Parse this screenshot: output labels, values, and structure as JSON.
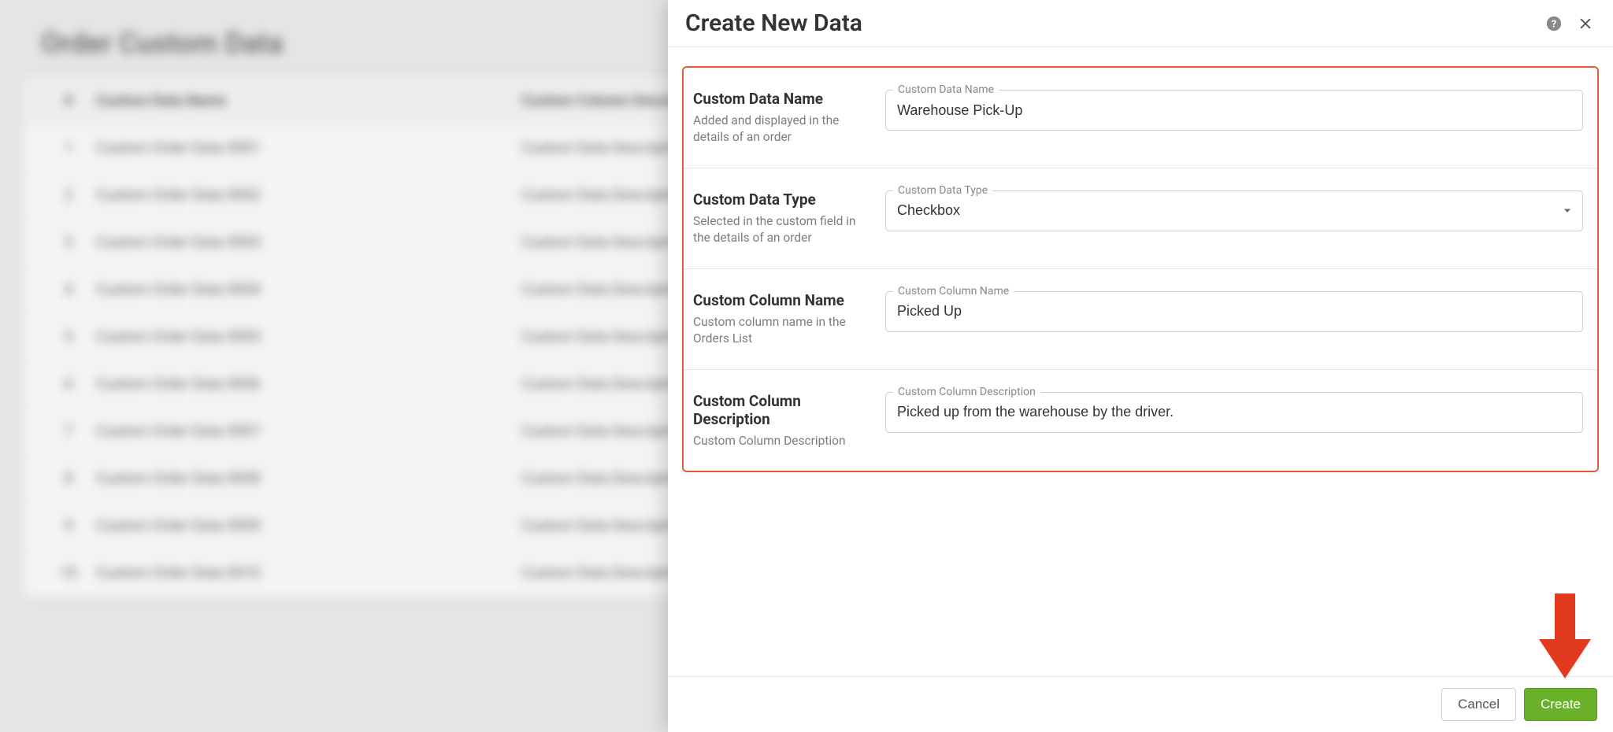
{
  "bg": {
    "title": "Order Custom Data",
    "header_idx": "#",
    "header_name": "Custom Data Name",
    "header_desc": "Custom Column Description",
    "desc_cell": "Custom Data Description",
    "rows": [
      {
        "idx": "1",
        "name": "Custom Order Data 0001"
      },
      {
        "idx": "2",
        "name": "Custom Order Data 0002"
      },
      {
        "idx": "3",
        "name": "Custom Order Data 0003"
      },
      {
        "idx": "4",
        "name": "Custom Order Data 0004"
      },
      {
        "idx": "5",
        "name": "Custom Order Data 0005"
      },
      {
        "idx": "6",
        "name": "Custom Order Data 0006"
      },
      {
        "idx": "7",
        "name": "Custom Order Data 0007"
      },
      {
        "idx": "8",
        "name": "Custom Order Data 0008"
      },
      {
        "idx": "9",
        "name": "Custom Order Data 0009"
      },
      {
        "idx": "10",
        "name": "Custom Order Data 0010"
      }
    ]
  },
  "drawer": {
    "title": "Create New Data",
    "sections": {
      "name": {
        "title": "Custom Data Name",
        "desc": "Added and displayed in the details of an order",
        "label": "Custom Data Name",
        "value": "Warehouse Pick-Up"
      },
      "type": {
        "title": "Custom Data Type",
        "desc": "Selected in the custom field in the details of an order",
        "label": "Custom Data Type",
        "value": "Checkbox"
      },
      "colname": {
        "title": "Custom Column Name",
        "desc": "Custom column name in the Orders List",
        "label": "Custom Column Name",
        "value": "Picked Up"
      },
      "coldesc": {
        "title": "Custom Column Description",
        "desc": "Custom Column Description",
        "label": "Custom Column Description",
        "value": "Picked up from the warehouse by the driver."
      }
    },
    "footer": {
      "cancel": "Cancel",
      "create": "Create"
    }
  }
}
